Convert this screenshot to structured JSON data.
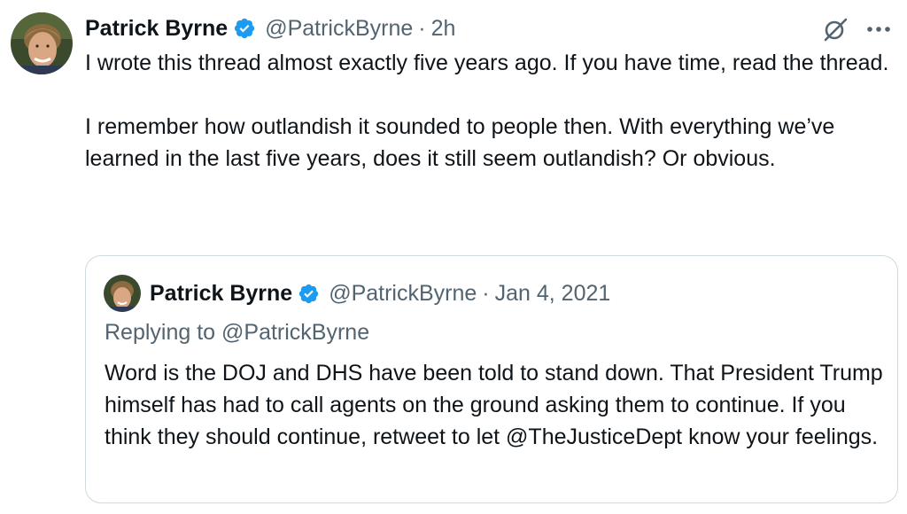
{
  "colors": {
    "text_primary": "#0f1419",
    "text_secondary": "#536471",
    "verified_blue": "#1d9bf0",
    "card_border": "#cfd9de"
  },
  "tweet": {
    "author": {
      "display_name": "Patrick Byrne",
      "handle": "@PatrickByrne",
      "verified": true,
      "avatar_icon": "avatar-photo"
    },
    "separator": "·",
    "timestamp": "2h",
    "actions": {
      "grok_icon": "grok-icon",
      "more_icon": "more-icon"
    },
    "paragraphs": [
      "I wrote this thread almost exactly five years ago. If you have time, read the thread.",
      "I remember how outlandish it sounded to people then. With everything we’ve learned in the last five years, does it still seem outlandish? Or obvious."
    ]
  },
  "quoted_tweet": {
    "author": {
      "display_name": "Patrick Byrne",
      "handle": "@PatrickByrne",
      "verified": true,
      "avatar_icon": "avatar-photo"
    },
    "separator": "·",
    "timestamp": "Jan 4, 2021",
    "replying_to": "Replying to @PatrickByrne",
    "text": "Word is the DOJ and DHS have been told to stand down. That President Trump himself has had to call agents on the ground asking them to continue. If you think they should continue, retweet to let @TheJusticeDept know your feelings."
  }
}
